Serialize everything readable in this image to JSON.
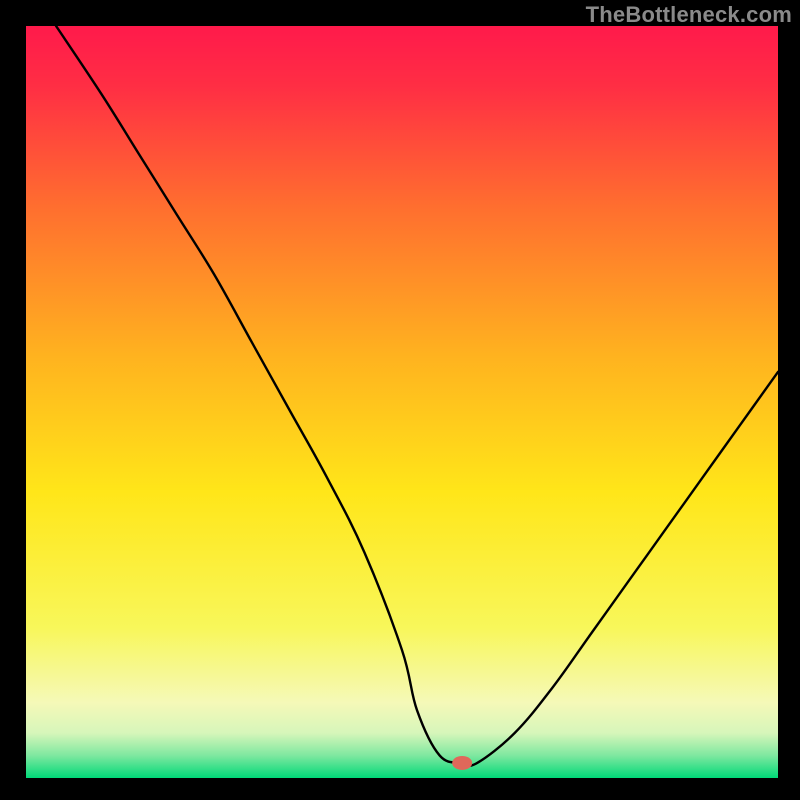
{
  "watermark": "TheBottleneck.com",
  "chart_data": {
    "type": "line",
    "title": "",
    "xlabel": "",
    "ylabel": "",
    "xlim": [
      0,
      100
    ],
    "ylim": [
      0,
      100
    ],
    "grid": false,
    "legend": false,
    "series": [
      {
        "name": "bottleneck-curve",
        "x": [
          4,
          10,
          15,
          20,
          25,
          30,
          35,
          40,
          45,
          50,
          52,
          55,
          58,
          60,
          65,
          70,
          75,
          80,
          85,
          90,
          95,
          100
        ],
        "values": [
          100,
          91,
          83,
          75,
          67,
          58,
          49,
          40,
          30,
          17,
          9,
          3,
          2,
          2,
          6,
          12,
          19,
          26,
          33,
          40,
          47,
          54
        ]
      }
    ],
    "annotations": [
      {
        "name": "zero-marker",
        "x": 58,
        "y": 2,
        "color": "#e0685a"
      }
    ],
    "background_gradient": {
      "top": "#ff1a4b",
      "middle": "#ffe619",
      "bottom": "#00d978"
    }
  }
}
